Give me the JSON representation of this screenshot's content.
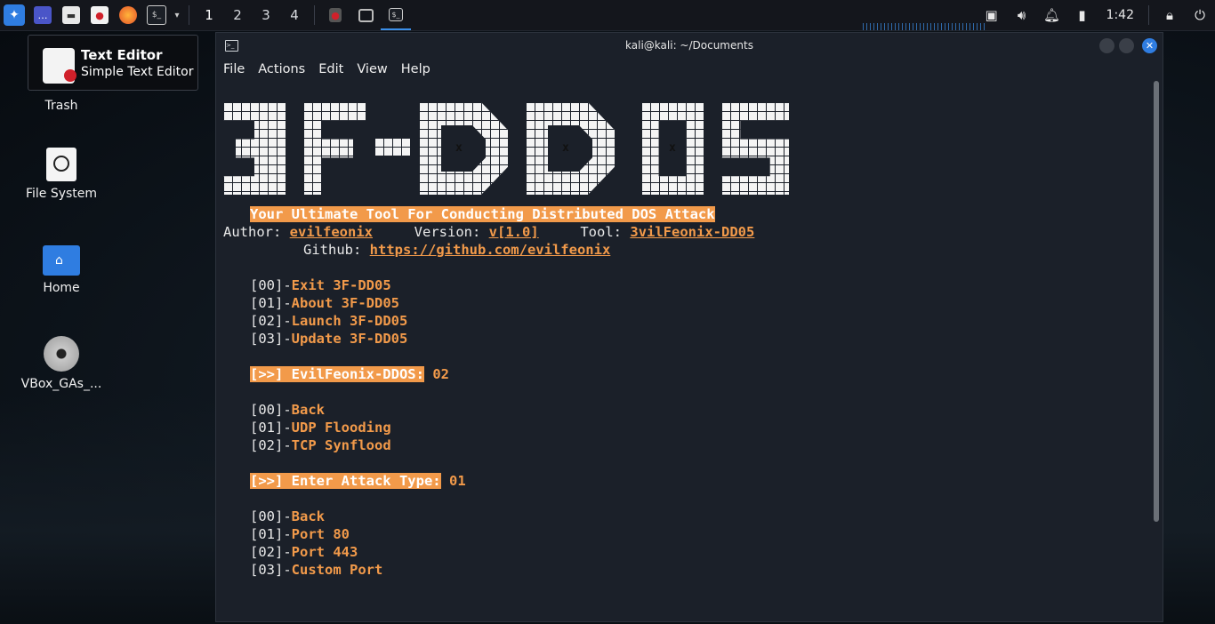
{
  "taskbar": {
    "workspaces": [
      "1",
      "2",
      "3",
      "4"
    ],
    "clock": "1:42"
  },
  "desktop": {
    "tooltip": {
      "title": "Text Editor",
      "subtitle": "Simple Text Editor"
    },
    "icons": [
      {
        "label": "Trash"
      },
      {
        "label": "File System"
      },
      {
        "label": "Home"
      },
      {
        "label": "VBox_GAs_..."
      }
    ]
  },
  "terminal": {
    "title": "kali@kali: ~/Documents",
    "menu": [
      "File",
      "Actions",
      "Edit",
      "View",
      "Help"
    ],
    "banner_text": "3F-DD05",
    "banner_marks": [
      "x",
      "x",
      "x"
    ],
    "tagline": "Your Ultimate Tool For Conducting Distributed DOS Attack",
    "author_label": "Author:",
    "author": "evilfeonix",
    "version_label": "Version:",
    "version": "v[1.0]",
    "tool_label": "Tool:",
    "tool": "3vilFeonix-DD05",
    "github_label": "Github:",
    "github": "https://github.com/evilfeonix",
    "main_menu": [
      {
        "num": "[00]-",
        "label": "Exit 3F-DD05"
      },
      {
        "num": "[01]-",
        "label": "About 3F-DD05"
      },
      {
        "num": "[02]-",
        "label": "Launch 3F-DD05"
      },
      {
        "num": "[03]-",
        "label": "Update 3F-DD05"
      }
    ],
    "prompt1": {
      "label": "[>>] EvilFeonix-DDOS:",
      "input": "02"
    },
    "attack_menu": [
      {
        "num": "[00]-",
        "label": "Back"
      },
      {
        "num": "[01]-",
        "label": "UDP Flooding"
      },
      {
        "num": "[02]-",
        "label": "TCP Synflood"
      }
    ],
    "prompt2": {
      "label": "[>>] Enter Attack Type:",
      "input": "01"
    },
    "port_menu": [
      {
        "num": "[00]-",
        "label": "Back"
      },
      {
        "num": "[01]-",
        "label": "Port 80"
      },
      {
        "num": "[02]-",
        "label": "Port 443"
      },
      {
        "num": "[03]-",
        "label": "Custom Port"
      }
    ]
  }
}
